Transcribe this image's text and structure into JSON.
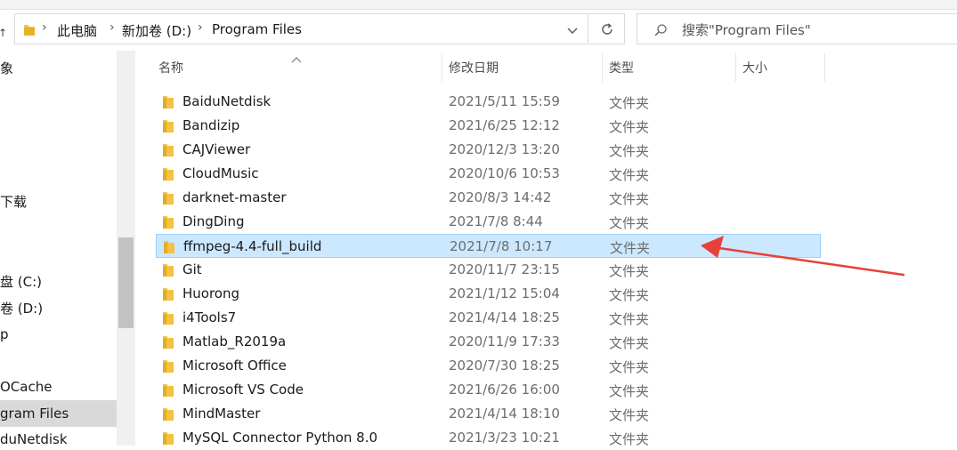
{
  "address": {
    "crumbs": [
      "此电脑",
      "新加卷 (D:)",
      "Program Files"
    ]
  },
  "search": {
    "placeholder": "搜索\"Program Files\""
  },
  "nav": {
    "items": [
      "象",
      "下载",
      "盘 (C:)",
      "卷 (D:)",
      "p",
      "OCache",
      "gram Files",
      "duNetdisk"
    ],
    "selected_index": 6
  },
  "columns": {
    "name": "名称",
    "date": "修改日期",
    "type": "类型",
    "size": "大小"
  },
  "files": [
    {
      "name": "BaiduNetdisk",
      "date": "2021/5/11 15:59",
      "type": "文件夹"
    },
    {
      "name": "Bandizip",
      "date": "2021/6/25 12:12",
      "type": "文件夹"
    },
    {
      "name": "CAJViewer",
      "date": "2020/12/3 13:20",
      "type": "文件夹"
    },
    {
      "name": "CloudMusic",
      "date": "2020/10/6 10:53",
      "type": "文件夹"
    },
    {
      "name": "darknet-master",
      "date": "2020/8/3 14:42",
      "type": "文件夹"
    },
    {
      "name": "DingDing",
      "date": "2021/7/8 8:44",
      "type": "文件夹"
    },
    {
      "name": "ffmpeg-4.4-full_build",
      "date": "2021/7/8 10:17",
      "type": "文件夹"
    },
    {
      "name": "Git",
      "date": "2020/11/7 23:15",
      "type": "文件夹"
    },
    {
      "name": "Huorong",
      "date": "2021/1/12 15:04",
      "type": "文件夹"
    },
    {
      "name": "i4Tools7",
      "date": "2021/4/14 18:25",
      "type": "文件夹"
    },
    {
      "name": "Matlab_R2019a",
      "date": "2020/11/9 17:33",
      "type": "文件夹"
    },
    {
      "name": "Microsoft Office",
      "date": "2020/7/30 18:25",
      "type": "文件夹"
    },
    {
      "name": "Microsoft VS Code",
      "date": "2021/6/26 16:00",
      "type": "文件夹"
    },
    {
      "name": "MindMaster",
      "date": "2021/4/14 18:10",
      "type": "文件夹"
    },
    {
      "name": "MySQL Connector Python 8.0",
      "date": "2021/3/23 10:21",
      "type": "文件夹"
    }
  ],
  "selected_file_index": 6,
  "colors": {
    "selection_bg": "#cce8ff",
    "selection_border": "#99d1ff",
    "folder": "#f5c342",
    "annotation_arrow": "#e8403a"
  }
}
